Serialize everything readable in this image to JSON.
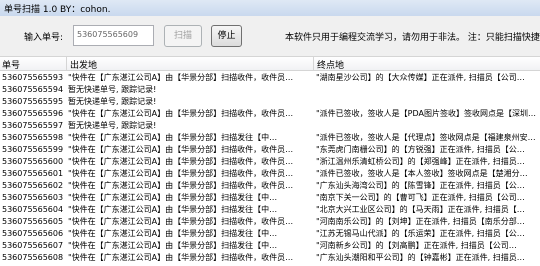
{
  "window": {
    "title": "单号扫描 1.0 BY：cohon."
  },
  "toolbar": {
    "input_label": "输入单号:",
    "input_value": "536075565609",
    "scan_label": "扫描",
    "stop_label": "停止",
    "notice": "本软件只用于编程交流学习，请勿用于非法。 注：只能扫描快捷快递"
  },
  "table": {
    "columns": [
      "单号",
      "出发地",
      "终点地"
    ],
    "rows": [
      [
        "536075565593",
        "\"快件在【广东湛江公司A】由【华景分部】扫描收件，收件员…",
        "\"湖南星沙公司】的【大众传媒】正在派件, 扫描员【公司…"
      ],
      [
        "536075565594",
        "暂无快递单号, 跟踪记录!",
        ""
      ],
      [
        "536075565595",
        "暂无快递单号, 跟踪记录!",
        ""
      ],
      [
        "536075565596",
        "\"快件在【广东湛江公司A】由【华景分部】扫描收件，收件员…",
        "\"派件已签收，签收人是【PDA图片签收】签收网点是【深圳…"
      ],
      [
        "536075565597",
        "暂无快递单号, 跟踪记录!",
        ""
      ],
      [
        "536075565598",
        "\"快件在【广东湛江公司A】由【华景分部】扫描发往【中…",
        "\"派件已签收，签收人是【代理点】签收网点是【福建泉州安…"
      ],
      [
        "536075565599",
        "\"快件在【广东湛江公司A】由【华景分部】扫描收件，收件员…",
        "\"东莞虎门南栅公司】的【方锐强】正在派件, 扫描员【公…"
      ],
      [
        "536075565600",
        "\"快件在【广东湛江公司A】由【华景分部】扫描收件，收件员…",
        "\"浙江温州乐清虹桥公司】的【郑强峰】正在派件, 扫描员…"
      ],
      [
        "536075565601",
        "\"快件在【广东湛江公司A】由【华景分部】扫描收件，收件员…",
        "\"派件已签收，签收人是【本人签收】签收网点是【楚湘分…"
      ],
      [
        "536075565602",
        "\"快件在【广东湛江公司A】由【华景分部】扫描收件，收件员…",
        "\"广东汕头海湾公司】的【陈雪锋】正在派件, 扫描员【公…"
      ],
      [
        "536075565603",
        "\"快件在【广东湛江公司A】由【华景分部】扫描发往【中…",
        "\"南京下关一公司】的【曹可飞】正在派件, 扫描员【公司…"
      ],
      [
        "536075565604",
        "\"快件在【广东湛江公司A】由【华景分部】扫描发往【中…",
        "\"北京大兴工业区公司】的【马天雨】正在派件, 扫描员【…"
      ],
      [
        "536075565605",
        "\"快件在【广东湛江公司A】由【华景分部】扫描收件，收件员…",
        "\"河南南乐公司】的【刘坤】正在派件, 扫描员【南乐分部…"
      ],
      [
        "536075565606",
        "\"快件在【广东湛江公司A】由【华景分部】扫描发往【中…",
        "\"江苏无锡马山代派】的【乐运荣】正在派件, 扫描员【公…"
      ],
      [
        "536075565607",
        "\"快件在【广东湛江公司A】由【华景分部】扫描发往【中…",
        "\"河南新乡公司】的【刘高鹏】正在派件, 扫描员【公司…"
      ],
      [
        "536075565608",
        "\"快件在【广东湛江公司A】由【华景分部】扫描收件，收件员…",
        "\"广东汕头潮阳和平公司】的【钟嘉彬】正在派件, 扫描员…"
      ]
    ]
  }
}
